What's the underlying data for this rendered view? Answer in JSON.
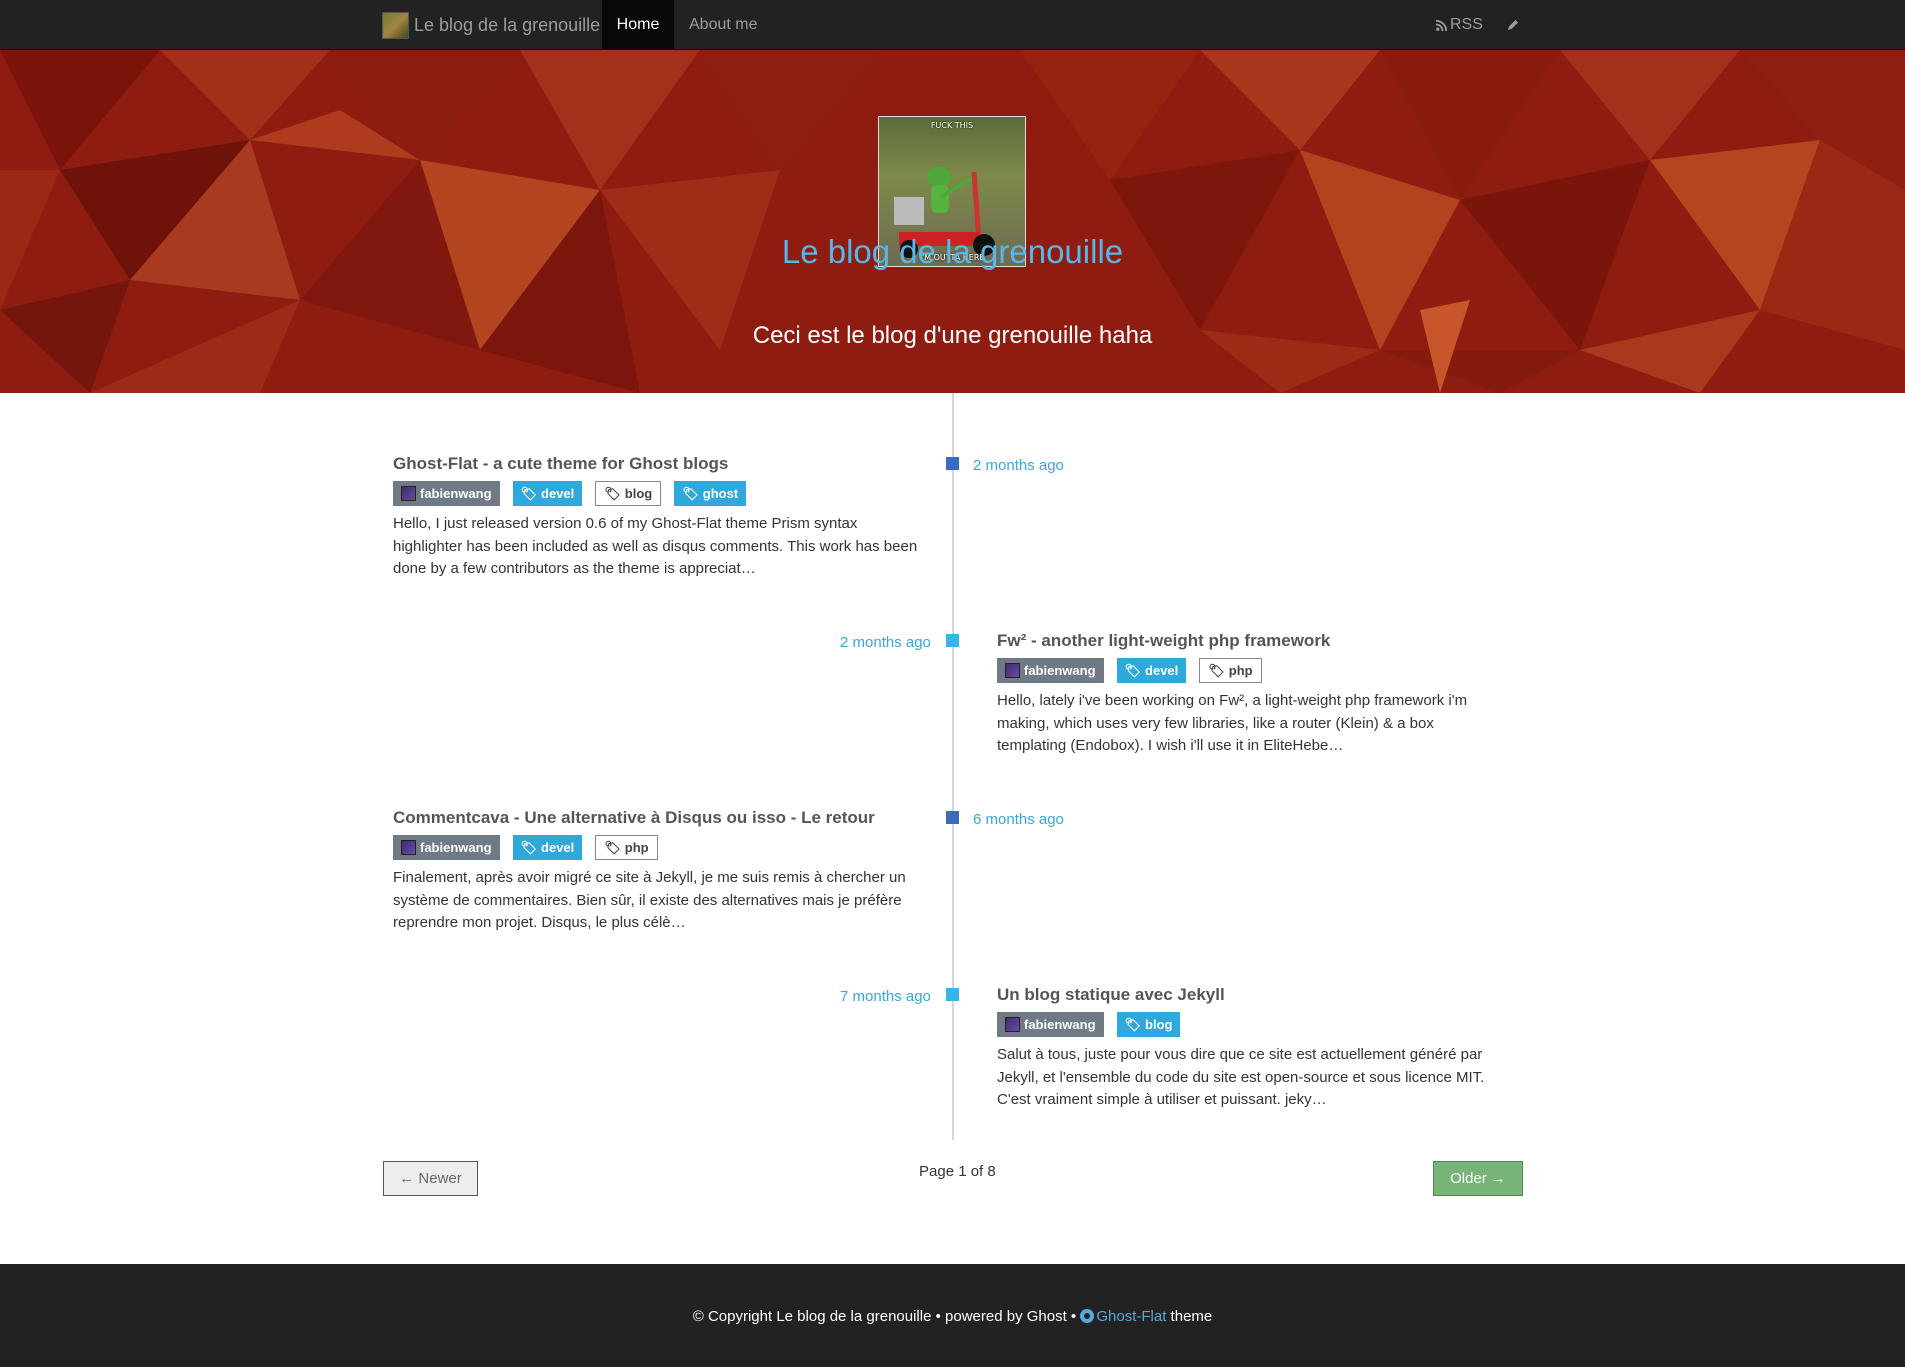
{
  "nav": {
    "brand": "Le blog de la grenouille",
    "items": [
      {
        "label": "Home"
      },
      {
        "label": "About me"
      }
    ],
    "rss_label": "RSS"
  },
  "hero": {
    "avatar_caption_top": "FUCK THIS",
    "avatar_caption_bottom": "I'M OUTTA HERE",
    "title": "Le blog de la grenouille",
    "subtitle": "Ceci est le blog d'une grenouille haha"
  },
  "posts": [
    {
      "title": "Ghost-Flat - a cute theme for Ghost blogs",
      "time": "2 months ago",
      "author": "fabienwang",
      "tags": [
        "devel",
        "blog",
        "ghost"
      ],
      "excerpt": "Hello, I just released version 0.6 of my Ghost-Flat theme Prism syntax highlighter has been included as well as disqus comments. This work has been done by a few contributors as the theme is appreciat…"
    },
    {
      "title": "Fw² - another light-weight php framework",
      "time": "2 months ago",
      "author": "fabienwang",
      "tags": [
        "devel",
        "php"
      ],
      "excerpt": "Hello, lately i've been working on Fw², a light-weight php framework i'm making, which uses very few libraries, like a router (Klein) & a box templating (Endobox). I wish i'll use it in EliteHebe…"
    },
    {
      "title": "Commentcava - Une alternative à Disqus ou isso - Le retour",
      "time": "6 months ago",
      "author": "fabienwang",
      "tags": [
        "devel",
        "php"
      ],
      "excerpt": "Finalement, après avoir migré ce site à Jekyll, je me suis remis à chercher un système de commentaires. Bien sûr, il existe des alternatives mais je préfère reprendre mon projet. Disqus, le plus célè…"
    },
    {
      "title": "Un blog statique avec Jekyll",
      "time": "7 months ago",
      "author": "fabienwang",
      "tags": [
        "blog"
      ],
      "excerpt": "Salut à tous, juste pour vous dire que ce site est actuellement généré par Jekyll, et l'ensemble du code du site est open-source et sous licence MIT. C'est vraiment simple à utiliser et puissant. jeky…"
    }
  ],
  "pagination": {
    "newer": "← Newer",
    "page": "Page 1 of 8",
    "older": "Older →"
  },
  "footer": {
    "prefix": "© Copyright Le blog de la grenouille • powered by Ghost • ",
    "theme_link": "Ghost-Flat",
    "suffix": " theme"
  },
  "colors": {
    "navbar": "#222222",
    "hero_red": "#8b1a0e",
    "accent_blue": "#2fa8dc",
    "hero_title": "#56b7ea",
    "older_green": "#78b478"
  }
}
